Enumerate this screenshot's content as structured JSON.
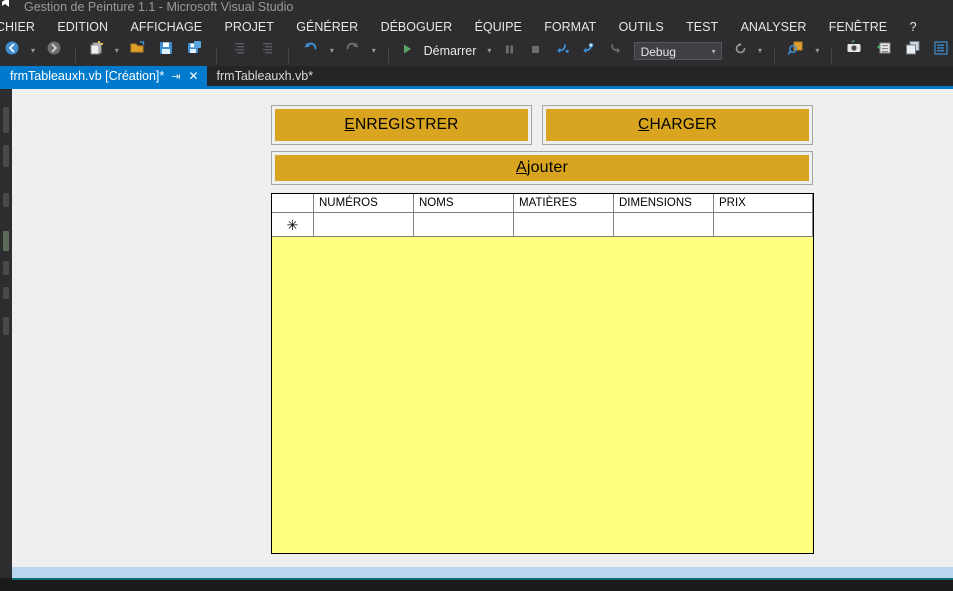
{
  "window": {
    "title": "Gestion de Peinture 1.1 - Microsoft Visual Studio",
    "logo_icon": "visual-studio-logo-icon"
  },
  "menubar": {
    "items": [
      {
        "label": "CHIER"
      },
      {
        "label": "EDITION"
      },
      {
        "label": "AFFICHAGE"
      },
      {
        "label": "PROJET"
      },
      {
        "label": "GÉNÉRER"
      },
      {
        "label": "DÉBOGUER"
      },
      {
        "label": "ÉQUIPE"
      },
      {
        "label": "FORMAT"
      },
      {
        "label": "OUTILS"
      },
      {
        "label": "TEST"
      },
      {
        "label": "ANALYSER"
      },
      {
        "label": "FENÊTRE"
      },
      {
        "label": "?"
      }
    ]
  },
  "toolbar": {
    "navigate_back_icon": "navigate-back-icon",
    "navigate_forward_icon": "navigate-forward-icon",
    "new_item_icon": "new-item-icon",
    "open_file_icon": "open-file-icon",
    "save_icon": "save-icon",
    "save_all_icon": "save-all-icon",
    "indent_icon": "increase-indent-icon",
    "outdent_icon": "decrease-indent-icon",
    "undo_icon": "undo-icon",
    "redo_icon": "redo-icon",
    "start_icon": "start-play-icon",
    "start_label": "Démarrer",
    "pause_icon": "pause-icon",
    "stop_icon": "stop-icon",
    "step_into_icon": "step-into-icon",
    "step_over_icon": "step-over-icon",
    "step_out_icon": "step-out-icon",
    "config_value": "Debug",
    "refresh_icon": "refresh-icon",
    "find_icon": "quick-find-icon",
    "camera_icon": "screenshot-camera-icon",
    "properties_window_icon": "properties-window-icon",
    "object_browser_icon": "object-browser-icon",
    "task_list_icon": "task-list-icon",
    "toolbox_icon": "toolbox-grid-icon",
    "pin_icon": "pin-icon",
    "camera2_icon": "camera-tool-icon",
    "caret_icon": "chevron-down-icon"
  },
  "tabs": [
    {
      "label": "frmTableauxh.vb [Création]*",
      "active": true,
      "pin_icon": "pin-icon",
      "close_icon": "close-icon"
    },
    {
      "label": "frmTableauxh.vb*",
      "active": false
    }
  ],
  "form": {
    "buttons": [
      {
        "name": "enregistrer-button",
        "accel": "E",
        "rest": "NREGISTRER"
      },
      {
        "name": "charger-button",
        "accel": "C",
        "rest": "HARGER"
      },
      {
        "name": "ajouter-button",
        "accel": "A",
        "rest": "jouter"
      }
    ],
    "grid": {
      "row_header_marker": "✳",
      "columns": [
        "NUMÉROS",
        "NOMS",
        "MATIÈRES",
        "DIMENSIONS",
        "PRIX"
      ],
      "rows": [
        {
          "cells": [
            "",
            "",
            "",
            "",
            ""
          ]
        }
      ],
      "background_color": "#ffff80"
    }
  },
  "colors": {
    "accent": "#007acc",
    "button_gold": "#d9a521",
    "grid_yellow": "#ffff80",
    "chrome_dark": "#2d2d30",
    "form_gray": "#efeff0"
  }
}
